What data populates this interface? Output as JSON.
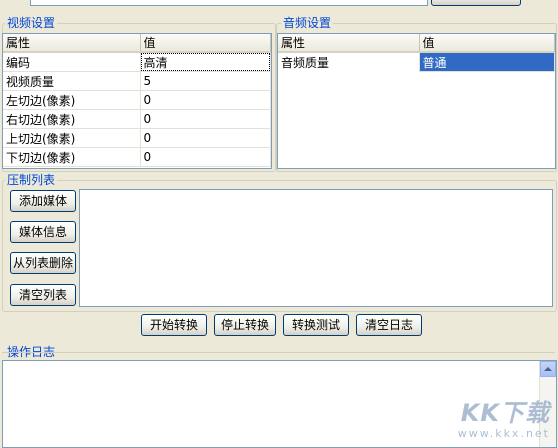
{
  "video_settings": {
    "title": "视频设置",
    "headers": [
      "属性",
      "值"
    ],
    "rows": [
      {
        "prop": "编码",
        "value": "高清"
      },
      {
        "prop": "视频质量",
        "value": "5"
      },
      {
        "prop": "左切边(像素)",
        "value": "0"
      },
      {
        "prop": "右切边(像素)",
        "value": "0"
      },
      {
        "prop": "上切边(像素)",
        "value": "0"
      },
      {
        "prop": "下切边(像素)",
        "value": "0"
      }
    ]
  },
  "audio_settings": {
    "title": "音频设置",
    "headers": [
      "属性",
      "值"
    ],
    "rows": [
      {
        "prop": "音频质量",
        "value": "普通"
      }
    ]
  },
  "compress_list": {
    "title": "压制列表",
    "buttons": {
      "add_media": "添加媒体",
      "media_info": "媒体信息",
      "remove": "从列表删除",
      "clear": "清空列表"
    }
  },
  "actions": {
    "start": "开始转换",
    "stop": "停止转换",
    "test": "转换测试",
    "clear_log": "清空日志"
  },
  "log": {
    "title": "操作日志",
    "content": ""
  },
  "watermark": {
    "logo": "KK下载",
    "url": "www.kkx.net"
  },
  "colors": {
    "window_bg": "#ECE9D8",
    "group_title": "#0046D5",
    "selection": "#316AC5"
  }
}
